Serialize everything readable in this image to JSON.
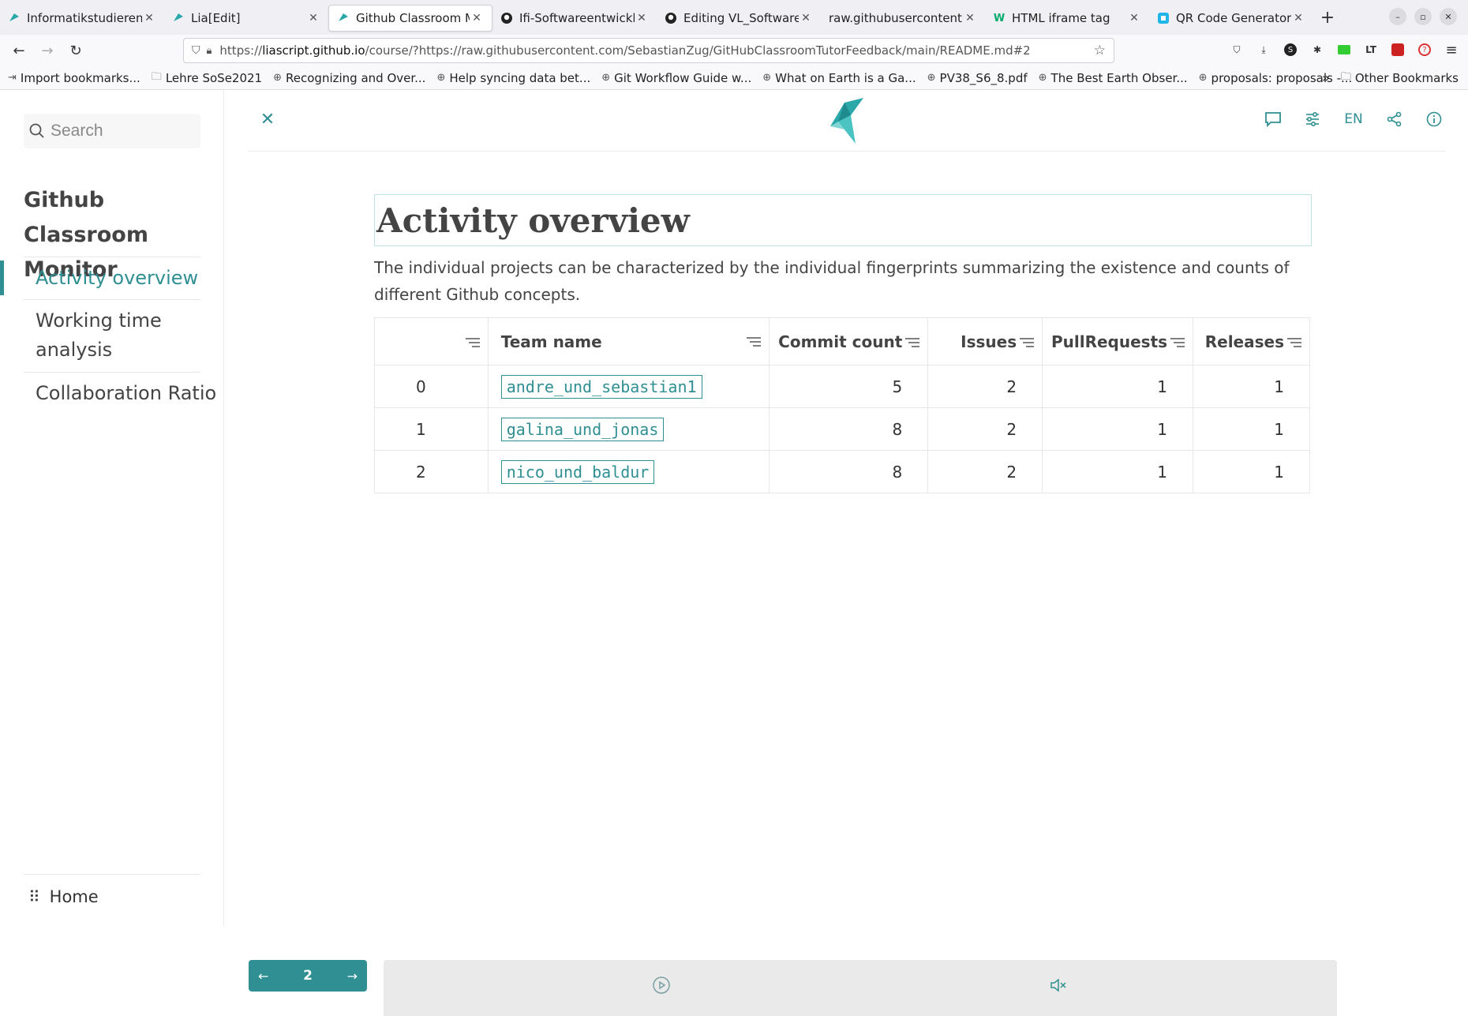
{
  "browser": {
    "tabs": [
      {
        "label": "Informatikstudierende",
        "icon": "liascript-icon",
        "active": false
      },
      {
        "label": "Lia[Edit]",
        "icon": "liascript-icon",
        "active": false
      },
      {
        "label": "Github Classroom Moni",
        "icon": "liascript-icon",
        "active": true
      },
      {
        "label": "Ifi-Softwareentwicklun",
        "icon": "github-icon",
        "active": false
      },
      {
        "label": "Editing VL_Softwareen",
        "icon": "github-icon",
        "active": false
      },
      {
        "label": "raw.githubusercontent.co",
        "icon": "",
        "active": false
      },
      {
        "label": "HTML iframe tag",
        "icon": "w3schools-icon",
        "active": false
      },
      {
        "label": "QR Code Generator | K",
        "icon": "qr-icon",
        "active": false
      }
    ],
    "url_prefix": "https://",
    "url_host": "liascript.github.io",
    "url_path": "/course/?https://raw.githubusercontent.com/SebastianZug/GitHubClassroomTutorFeedback/main/README.md#2",
    "bookmarks": [
      {
        "label": "Import bookmarks...",
        "icon": "import-icon"
      },
      {
        "label": "Lehre SoSe2021",
        "icon": "folder-icon"
      },
      {
        "label": "Recognizing and Over...",
        "icon": "globe-icon"
      },
      {
        "label": "Help syncing data bet...",
        "icon": "globe-icon"
      },
      {
        "label": "Git Workflow Guide w...",
        "icon": "globe-icon"
      },
      {
        "label": "What on Earth is a Ga...",
        "icon": "globe-icon"
      },
      {
        "label": "PV38_S6_8.pdf",
        "icon": "globe-icon"
      },
      {
        "label": "The Best Earth Obser...",
        "icon": "globe-icon"
      },
      {
        "label": "proposals: proposals -...",
        "icon": "globe-icon"
      }
    ],
    "other_bookmarks": "Other Bookmarks"
  },
  "sidebar": {
    "search_placeholder": "Search",
    "course_title": "Github Classroom Monitor",
    "items": [
      {
        "label": "Activity overview",
        "active": true
      },
      {
        "label": "Working time analysis",
        "active": false
      },
      {
        "label": "Collaboration Ratio",
        "active": false
      }
    ],
    "home_label": "Home"
  },
  "topbar": {
    "lang": "EN"
  },
  "main": {
    "title": "Activity overview",
    "intro": "The individual projects can be characterized by the individual fingerprints summarizing the existence and counts of different Github concepts.",
    "table": {
      "columns": [
        "",
        "Team name",
        "Commit count",
        "Issues",
        "PullRequests",
        "Releases"
      ],
      "rows": [
        {
          "index": "0",
          "team": "andre_und_sebastian1",
          "commits": "5",
          "issues": "2",
          "pulls": "1",
          "releases": "1"
        },
        {
          "index": "1",
          "team": "galina_und_jonas",
          "commits": "8",
          "issues": "2",
          "pulls": "1",
          "releases": "1"
        },
        {
          "index": "2",
          "team": "nico_und_baldur",
          "commits": "8",
          "issues": "2",
          "pulls": "1",
          "releases": "1"
        }
      ]
    }
  },
  "pager": {
    "current": "2"
  },
  "colors": {
    "accent": "#2f8f92"
  }
}
